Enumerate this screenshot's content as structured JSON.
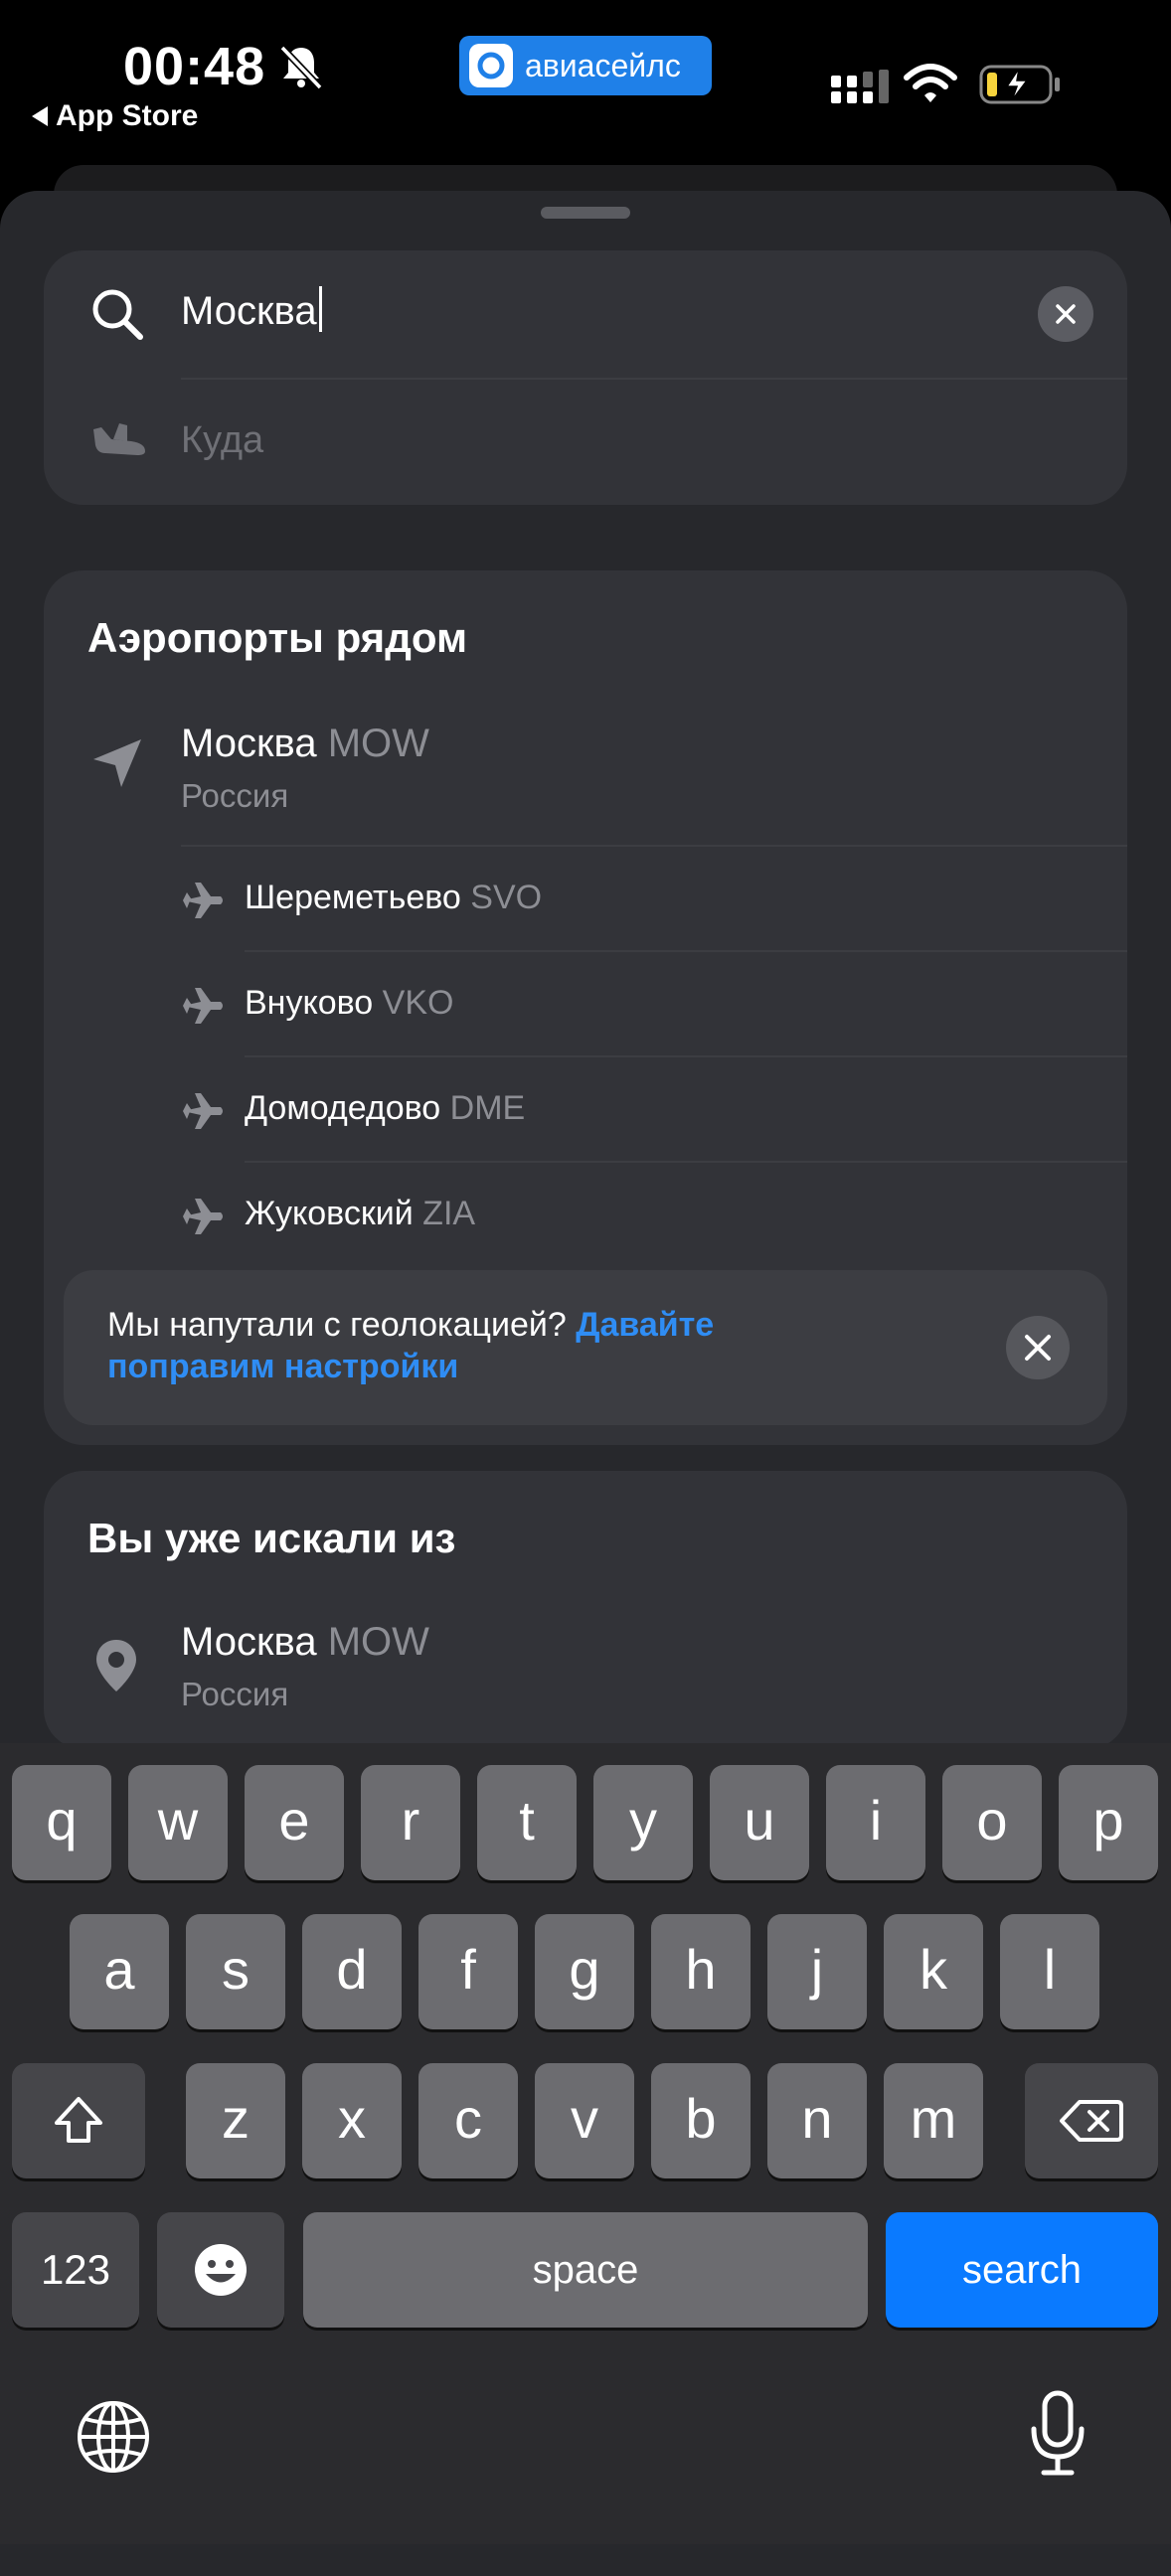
{
  "status_bar": {
    "time": "00:48",
    "back_label": "App Store",
    "brand": "авиасейлс"
  },
  "search": {
    "from_value": "Москва",
    "to_placeholder": "Куда"
  },
  "nearby": {
    "title": "Аэропорты рядом",
    "city": {
      "name": "Москва",
      "code": "MOW",
      "country": "Россия"
    },
    "airports": [
      {
        "name": "Шереметьево",
        "code": "SVO"
      },
      {
        "name": "Внуково",
        "code": "VKO"
      },
      {
        "name": "Домодедово",
        "code": "DME"
      },
      {
        "name": "Жуковский",
        "code": "ZIA"
      }
    ],
    "geo_banner": {
      "text": "Мы напутали с геолокацией?",
      "link": "Давайте поправим настройки"
    }
  },
  "history": {
    "title": "Вы уже искали из",
    "city": {
      "name": "Москва",
      "code": "MOW",
      "country": "Россия"
    }
  },
  "keyboard": {
    "row1": [
      "q",
      "w",
      "e",
      "r",
      "t",
      "y",
      "u",
      "i",
      "o",
      "p"
    ],
    "row2": [
      "a",
      "s",
      "d",
      "f",
      "g",
      "h",
      "j",
      "k",
      "l"
    ],
    "row3": [
      "z",
      "x",
      "c",
      "v",
      "b",
      "n",
      "m"
    ],
    "numbers_label": "123",
    "space_label": "space",
    "search_label": "search"
  },
  "colors": {
    "accent": "#0a7aff",
    "brand": "#1f80e8",
    "link": "#2f8df4"
  }
}
